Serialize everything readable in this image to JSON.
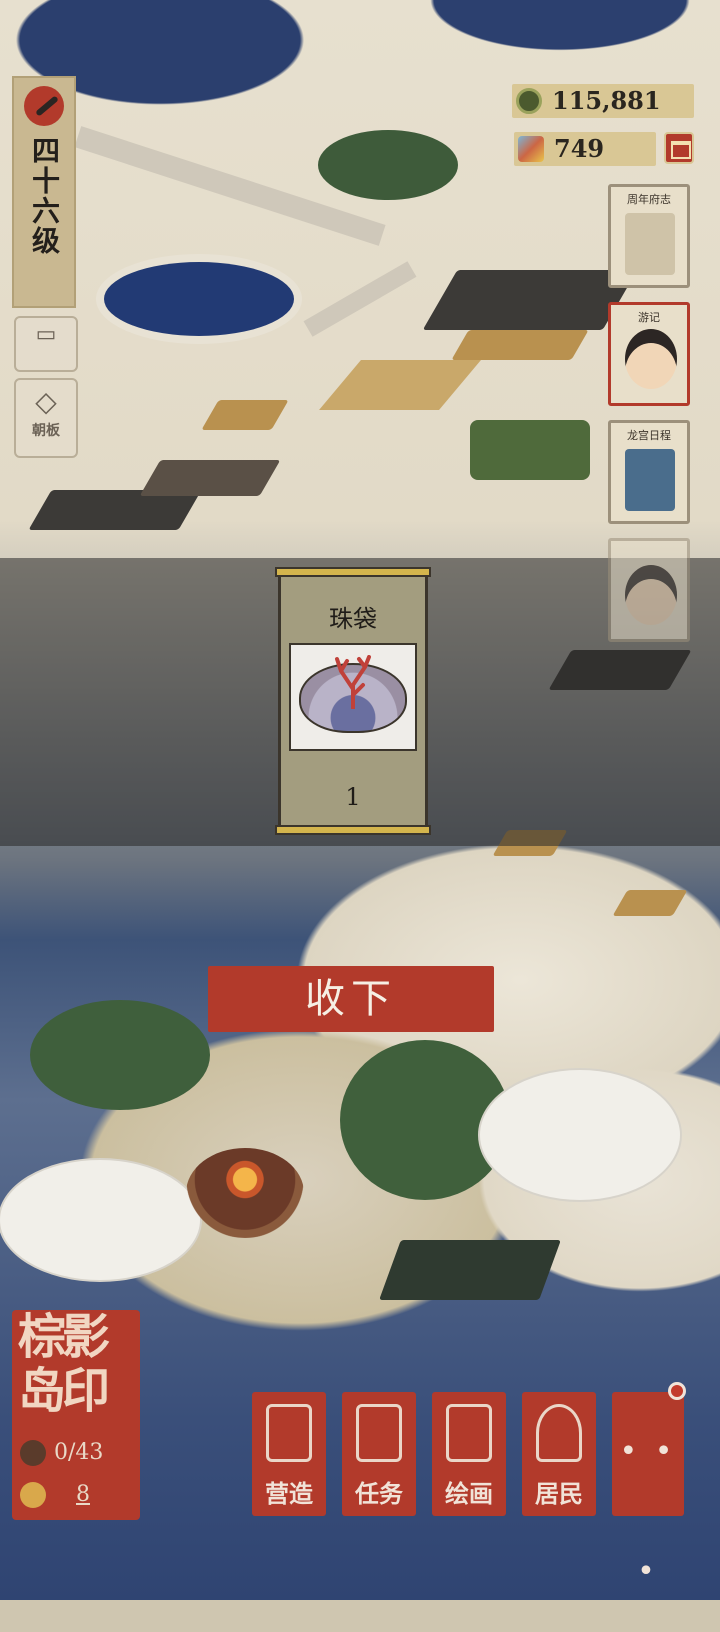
{
  "level": {
    "label": "四十六级"
  },
  "left_buttons": [
    {
      "icon": "chat-icon",
      "label": ""
    },
    {
      "icon": "book-icon",
      "label": "朝板"
    }
  ],
  "currency": [
    {
      "icon": "coin-icon",
      "value": "115,881"
    },
    {
      "icon": "jade-icon",
      "value": "749"
    }
  ],
  "right_cards": [
    {
      "label": "周年府志",
      "icon": "scroll-icon"
    },
    {
      "label": "游记",
      "icon": "portrait-icon"
    },
    {
      "label": "龙宫日程",
      "icon": "card-icon"
    },
    {
      "label": "",
      "icon": "character-icon"
    }
  ],
  "reward": {
    "name": "珠袋",
    "icon": "pearl-shell-icon",
    "quantity": "1"
  },
  "accept_button": "收下",
  "island": {
    "name": "棕影岛印",
    "population": "0/43",
    "count": "8"
  },
  "bottom_menu": [
    {
      "label": "营造",
      "icon": "build-icon"
    },
    {
      "label": "任务",
      "icon": "task-icon"
    },
    {
      "label": "绘画",
      "icon": "painting-icon"
    },
    {
      "label": "居民",
      "icon": "resident-icon"
    }
  ],
  "more_label": "• • •",
  "colors": {
    "accent_red": "#b23a2b",
    "parchment": "#d9c795",
    "water": "#2b3f6e"
  }
}
